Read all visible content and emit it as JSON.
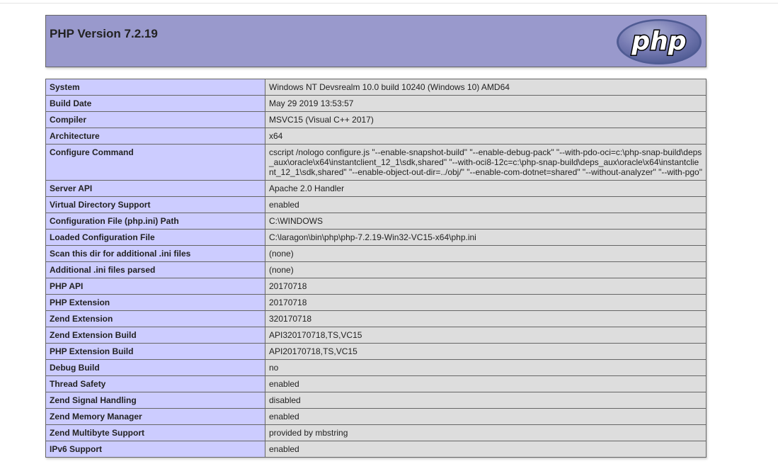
{
  "header": {
    "title": "PHP Version 7.2.19",
    "logo_text": "php"
  },
  "rows": [
    {
      "key": "System",
      "value": "Windows NT Devsrealm 10.0 build 10240 (Windows 10) AMD64"
    },
    {
      "key": "Build Date",
      "value": "May 29 2019 13:53:57"
    },
    {
      "key": "Compiler",
      "value": "MSVC15 (Visual C++ 2017)"
    },
    {
      "key": "Architecture",
      "value": "x64"
    },
    {
      "key": "Configure Command",
      "value": "cscript /nologo configure.js \"--enable-snapshot-build\" \"--enable-debug-pack\" \"--with-pdo-oci=c:\\php-snap-build\\deps_aux\\oracle\\x64\\instantclient_12_1\\sdk,shared\" \"--with-oci8-12c=c:\\php-snap-build\\deps_aux\\oracle\\x64\\instantclient_12_1\\sdk,shared\" \"--enable-object-out-dir=../obj/\" \"--enable-com-dotnet=shared\" \"--without-analyzer\" \"--with-pgo\""
    },
    {
      "key": "Server API",
      "value": "Apache 2.0 Handler"
    },
    {
      "key": "Virtual Directory Support",
      "value": "enabled"
    },
    {
      "key": "Configuration File (php.ini) Path",
      "value": "C:\\WINDOWS"
    },
    {
      "key": "Loaded Configuration File",
      "value": "C:\\laragon\\bin\\php\\php-7.2.19-Win32-VC15-x64\\php.ini"
    },
    {
      "key": "Scan this dir for additional .ini files",
      "value": "(none)"
    },
    {
      "key": "Additional .ini files parsed",
      "value": "(none)"
    },
    {
      "key": "PHP API",
      "value": "20170718"
    },
    {
      "key": "PHP Extension",
      "value": "20170718"
    },
    {
      "key": "Zend Extension",
      "value": "320170718"
    },
    {
      "key": "Zend Extension Build",
      "value": "API320170718,TS,VC15"
    },
    {
      "key": "PHP Extension Build",
      "value": "API20170718,TS,VC15"
    },
    {
      "key": "Debug Build",
      "value": "no"
    },
    {
      "key": "Thread Safety",
      "value": "enabled"
    },
    {
      "key": "Zend Signal Handling",
      "value": "disabled"
    },
    {
      "key": "Zend Memory Manager",
      "value": "enabled"
    },
    {
      "key": "Zend Multibyte Support",
      "value": "provided by mbstring"
    },
    {
      "key": "IPv6 Support",
      "value": "enabled"
    }
  ],
  "colors": {
    "header_bg": "#9999cc",
    "key_bg": "#ccccff",
    "value_bg": "#dddddd",
    "border": "#666666",
    "logo_fill": "#6c74b0",
    "logo_text": "#000000"
  }
}
